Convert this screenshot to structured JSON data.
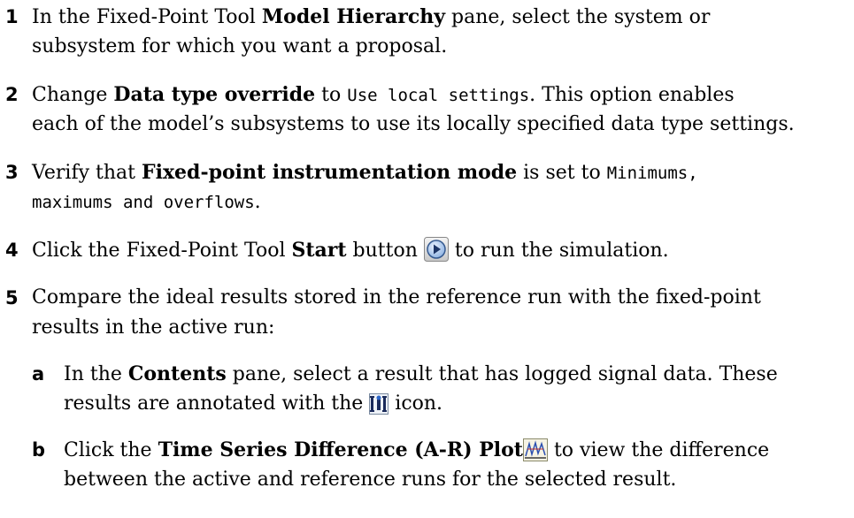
{
  "steps": [
    {
      "num": "1",
      "lines": [
        [
          "In the Fixed-Point Tool ",
          "Model Hierarchy",
          " pane, select the system or"
        ],
        [
          "subsystem for which you want a proposal."
        ]
      ]
    },
    {
      "num": "2",
      "l1a": "Change ",
      "l1b": "Data type override",
      "l1c": " to ",
      "l1code": "Use local settings",
      "l1d": ". This option enables",
      "l2": "each of the model’s subsystems to use its locally specified data type settings."
    },
    {
      "num": "3",
      "l1a": "Verify that ",
      "l1b": "Fixed-point instrumentation mode",
      "l1c": " is set to ",
      "l1code": "Minimums,",
      "l2code": "maximums and overflows",
      "l2d": "."
    },
    {
      "num": "4",
      "l1a": "Click the Fixed-Point Tool ",
      "l1b": "Start",
      "l1c": " button ",
      "l1d": " to run the simulation.",
      "icon": "start-simulation-icon"
    },
    {
      "num": "5",
      "l1": "Compare the ideal results stored in the reference run with the fixed-point",
      "l2": "results in the active run:",
      "sub": [
        {
          "num": "a",
          "l1a": "In the ",
          "l1b": "Contents",
          "l1c": " pane, select a result that has logged signal data. These",
          "l2a": "results are annotated with the ",
          "l2b": " icon.",
          "icon": "logged-signal-icon"
        },
        {
          "num": "b",
          "l1a": "Click the ",
          "l1b": "Time Series Difference (A-R) Plot",
          "l1c": " to view the difference",
          "l2": "between the active and reference runs for the selected result.",
          "icon": "difference-plot-icon"
        }
      ]
    }
  ]
}
